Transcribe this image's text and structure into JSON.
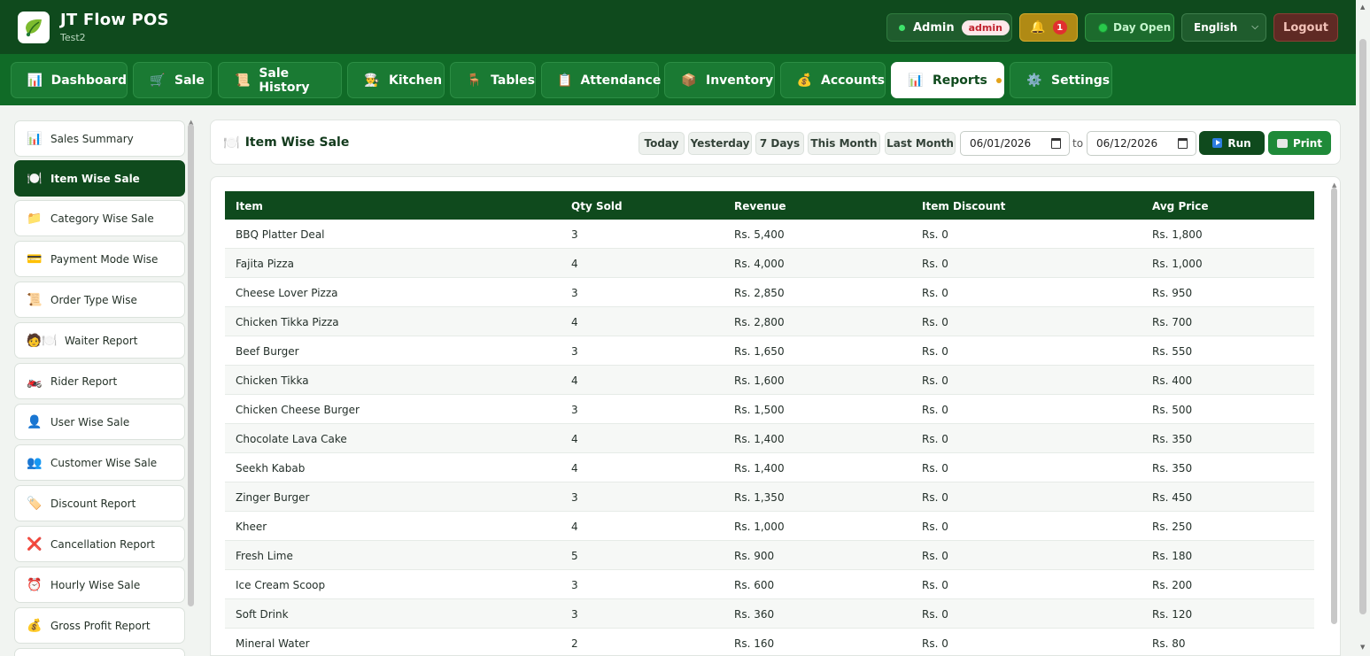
{
  "app": {
    "title": "JT Flow POS",
    "subtitle": "Test2"
  },
  "header": {
    "user": "Admin",
    "role": "admin",
    "notifications": "1",
    "day_status": "Day Open",
    "language": "English",
    "logout": "Logout"
  },
  "nav": [
    {
      "label": "Dashboard",
      "icon": "📊"
    },
    {
      "label": "Sale",
      "icon": "🛒"
    },
    {
      "label": "Sale History",
      "icon": "📜"
    },
    {
      "label": "Kitchen",
      "icon": "👨‍🍳"
    },
    {
      "label": "Tables",
      "icon": "🪑"
    },
    {
      "label": "Attendance",
      "icon": "📋"
    },
    {
      "label": "Inventory",
      "icon": "📦"
    },
    {
      "label": "Accounts",
      "icon": "💰"
    },
    {
      "label": "Reports",
      "icon": "📊"
    },
    {
      "label": "Settings",
      "icon": "⚙️"
    }
  ],
  "sidebar": [
    {
      "label": "Sales Summary",
      "icon": "📊"
    },
    {
      "label": "Item Wise Sale",
      "icon": "🍽️"
    },
    {
      "label": "Category Wise Sale",
      "icon": "📁"
    },
    {
      "label": "Payment Mode Wise",
      "icon": "💳"
    },
    {
      "label": "Order Type Wise",
      "icon": "📜"
    },
    {
      "label": "Waiter Report",
      "icon": "🧑🍽️"
    },
    {
      "label": "Rider Report",
      "icon": "🏍️"
    },
    {
      "label": "User Wise Sale",
      "icon": "👤"
    },
    {
      "label": "Customer Wise Sale",
      "icon": "👥"
    },
    {
      "label": "Discount Report",
      "icon": "🏷️"
    },
    {
      "label": "Cancellation Report",
      "icon": "❌"
    },
    {
      "label": "Hourly Wise Sale",
      "icon": "⏰"
    },
    {
      "label": "Gross Profit Report",
      "icon": "💰"
    }
  ],
  "report": {
    "title": "Item Wise Sale",
    "icon": "🍽️",
    "quick_filters": [
      "Today",
      "Yesterday",
      "7 Days",
      "This Month",
      "Last Month"
    ],
    "date_from": "06/01/2026",
    "to_label": "to",
    "date_to": "06/12/2026",
    "run_label": "Run",
    "print_label": "Print"
  },
  "table": {
    "columns": [
      "Item",
      "Qty Sold",
      "Revenue",
      "Item Discount",
      "Avg Price"
    ],
    "rows": [
      [
        "BBQ Platter Deal",
        "3",
        "Rs. 5,400",
        "Rs. 0",
        "Rs. 1,800"
      ],
      [
        "Fajita Pizza",
        "4",
        "Rs. 4,000",
        "Rs. 0",
        "Rs. 1,000"
      ],
      [
        "Cheese Lover Pizza",
        "3",
        "Rs. 2,850",
        "Rs. 0",
        "Rs. 950"
      ],
      [
        "Chicken Tikka Pizza",
        "4",
        "Rs. 2,800",
        "Rs. 0",
        "Rs. 700"
      ],
      [
        "Beef Burger",
        "3",
        "Rs. 1,650",
        "Rs. 0",
        "Rs. 550"
      ],
      [
        "Chicken Tikka",
        "4",
        "Rs. 1,600",
        "Rs. 0",
        "Rs. 400"
      ],
      [
        "Chicken Cheese Burger",
        "3",
        "Rs. 1,500",
        "Rs. 0",
        "Rs. 500"
      ],
      [
        "Chocolate Lava Cake",
        "4",
        "Rs. 1,400",
        "Rs. 0",
        "Rs. 350"
      ],
      [
        "Seekh Kabab",
        "4",
        "Rs. 1,400",
        "Rs. 0",
        "Rs. 350"
      ],
      [
        "Zinger Burger",
        "3",
        "Rs. 1,350",
        "Rs. 0",
        "Rs. 450"
      ],
      [
        "Kheer",
        "4",
        "Rs. 1,000",
        "Rs. 0",
        "Rs. 250"
      ],
      [
        "Fresh Lime",
        "5",
        "Rs. 900",
        "Rs. 0",
        "Rs. 180"
      ],
      [
        "Ice Cream Scoop",
        "3",
        "Rs. 600",
        "Rs. 0",
        "Rs. 200"
      ],
      [
        "Soft Drink",
        "3",
        "Rs. 360",
        "Rs. 0",
        "Rs. 120"
      ],
      [
        "Mineral Water",
        "2",
        "Rs. 160",
        "Rs. 0",
        "Rs. 80"
      ]
    ]
  }
}
